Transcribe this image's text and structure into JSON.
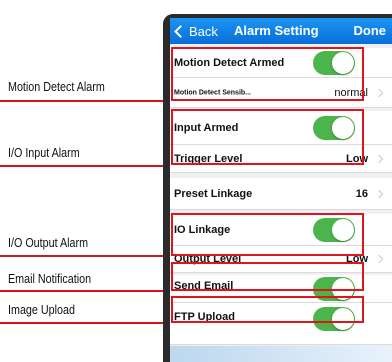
{
  "annotations": [
    {
      "label": "Motion Detect Alarm"
    },
    {
      "label": "I/O Input Alarm"
    },
    {
      "label": "I/O Output Alarm"
    },
    {
      "label": "Email Notification"
    },
    {
      "label": "Image Upload"
    }
  ],
  "navbar": {
    "back_label": "Back",
    "title": "Alarm Setting",
    "done_label": "Done"
  },
  "rows": {
    "motion_armed": {
      "label": "Motion Detect Armed",
      "toggle_on": true
    },
    "motion_sensitivity": {
      "label": "Motion Detect Sensib...",
      "value": "normal"
    },
    "input_armed": {
      "label": "Input Armed",
      "toggle_on": true
    },
    "trigger_level": {
      "label": "Trigger Level",
      "value": "Low"
    },
    "preset_linkage": {
      "label": "Preset Linkage",
      "value": "16"
    },
    "io_linkage": {
      "label": "IO Linkage",
      "toggle_on": true
    },
    "output_level": {
      "label": "Output Level",
      "value": "Low"
    },
    "send_email": {
      "label": "Send Email",
      "toggle_on": true
    },
    "ftp_upload": {
      "label": "FTP Upload",
      "toggle_on": true
    }
  },
  "colors": {
    "accent_red": "#e0141b",
    "nav_blue": "#0a80e4",
    "toggle_green": "#4bb54b"
  }
}
